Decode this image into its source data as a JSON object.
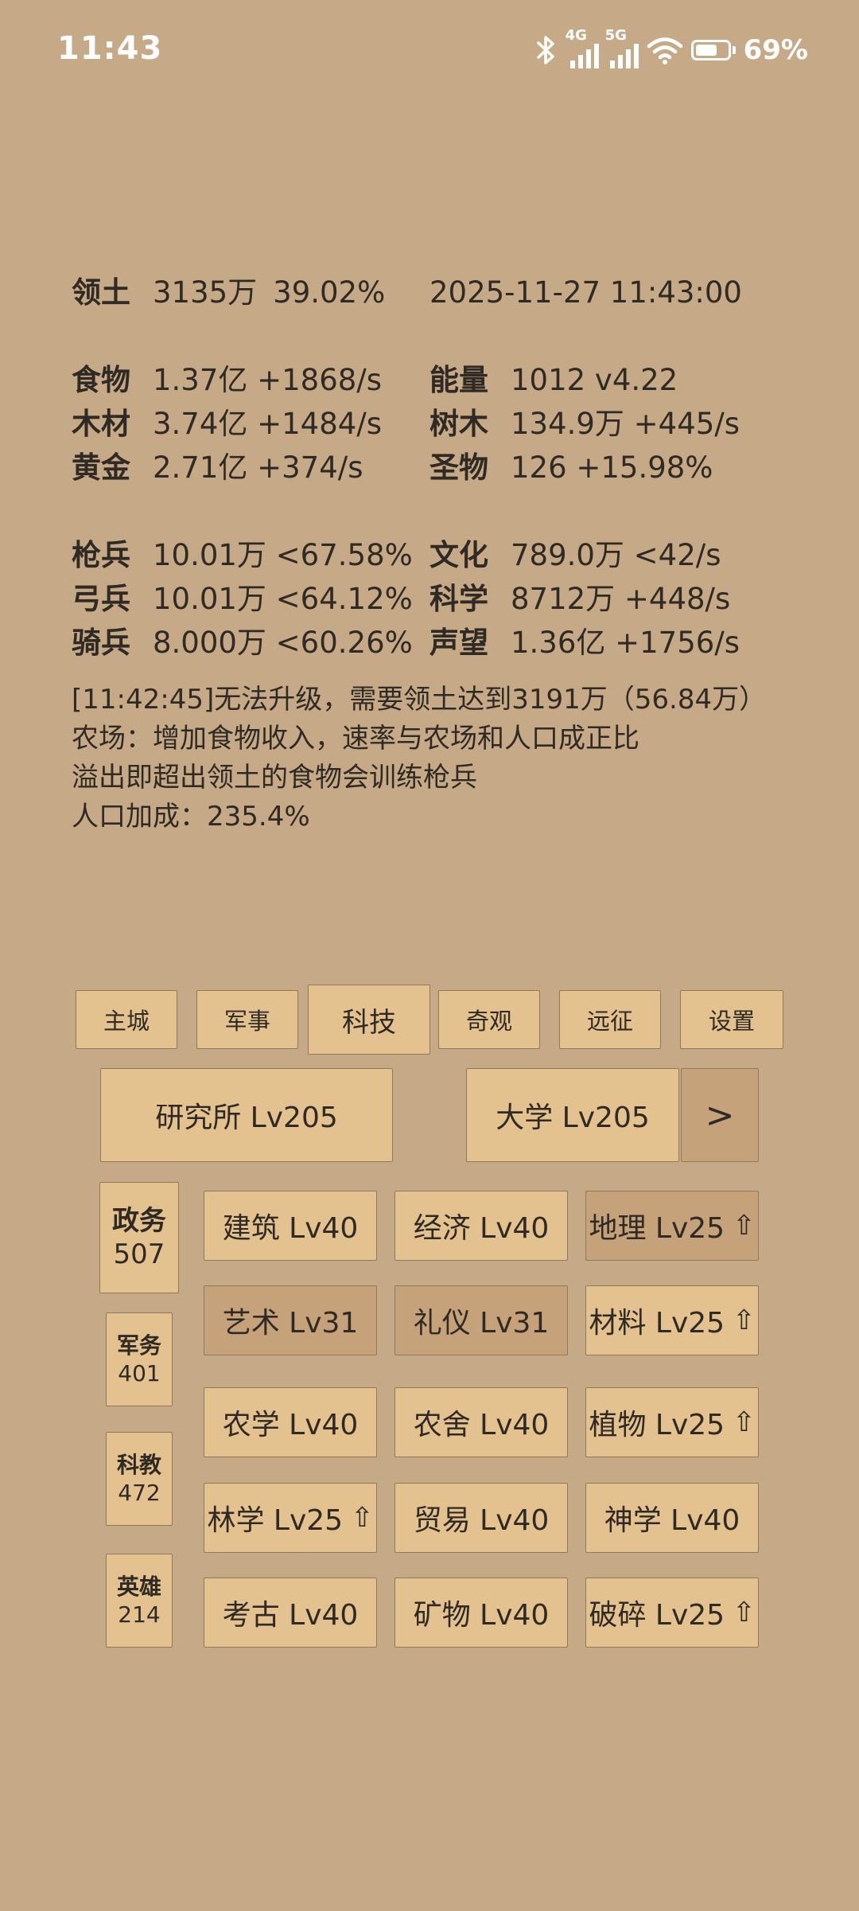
{
  "status_bar": {
    "time": "11:43",
    "network_4g": "4G",
    "network_5g": "5G",
    "battery_pct": "69%",
    "battery_level": 0.69,
    "icons": [
      "bluetooth-icon",
      "signal-4g-icon",
      "signal-5g-icon",
      "wifi-icon",
      "battery-icon"
    ]
  },
  "stats": {
    "territory_label": "领土",
    "territory_value": "3135万",
    "territory_pct": "39.02%",
    "datetime": "2025-11-27 11:43:00",
    "rows1": [
      {
        "k1": "食物",
        "v1": "1.37亿 +1868/s",
        "k2": "能量",
        "v2": "1012  v4.22"
      },
      {
        "k1": "木材",
        "v1": "3.74亿 +1484/s",
        "k2": "树木",
        "v2": "134.9万 +445/s"
      },
      {
        "k1": "黄金",
        "v1": "2.71亿 +374/s",
        "k2": "圣物",
        "v2": "126 +15.98%"
      }
    ],
    "rows2": [
      {
        "k1": "枪兵",
        "v1": "10.01万 <67.58%",
        "k2": "文化",
        "v2": "789.0万 <42/s"
      },
      {
        "k1": "弓兵",
        "v1": "10.01万 <64.12%",
        "k2": "科学",
        "v2": "8712万 +448/s"
      },
      {
        "k1": "骑兵",
        "v1": "8.000万 <60.26%",
        "k2": "声望",
        "v2": "1.36亿 +1756/s"
      }
    ]
  },
  "messages": {
    "line1": "[11:42:45]无法升级，需要领土达到3191万（56.84万）",
    "line2": "农场：增加食物收入，速率与农场和人口成正比",
    "line3": "溢出即超出领土的食物会训练枪兵",
    "line4": "人口加成：235.4%"
  },
  "tabs": [
    "主城",
    "军事",
    "科技",
    "奇观",
    "远征",
    "设置"
  ],
  "active_tab": "科技",
  "buildings": {
    "research": "研究所 Lv205",
    "university": "大学 Lv205",
    "next": ">"
  },
  "side": [
    {
      "title": "政务",
      "value": "507"
    },
    {
      "title": "军务",
      "value": "401"
    },
    {
      "title": "科教",
      "value": "472"
    },
    {
      "title": "英雄",
      "value": "214"
    }
  ],
  "upgrade_glyph": "⇧",
  "techs": [
    {
      "label": "建筑 Lv40",
      "up": false,
      "sel": false
    },
    {
      "label": "经济 Lv40",
      "up": false,
      "sel": false
    },
    {
      "label": "地理 Lv25",
      "up": true,
      "sel": true
    },
    {
      "label": "艺术 Lv31",
      "up": false,
      "sel": true
    },
    {
      "label": "礼仪 Lv31",
      "up": false,
      "sel": true
    },
    {
      "label": "材料 Lv25",
      "up": true,
      "sel": false
    },
    {
      "label": "农学 Lv40",
      "up": false,
      "sel": false
    },
    {
      "label": "农舍 Lv40",
      "up": false,
      "sel": false
    },
    {
      "label": "植物 Lv25",
      "up": true,
      "sel": false
    },
    {
      "label": "林学 Lv25",
      "up": true,
      "sel": false
    },
    {
      "label": "贸易 Lv40",
      "up": false,
      "sel": false
    },
    {
      "label": "神学 Lv40",
      "up": false,
      "sel": false
    },
    {
      "label": "考古 Lv40",
      "up": false,
      "sel": false
    },
    {
      "label": "矿物 Lv40",
      "up": false,
      "sel": false
    },
    {
      "label": "破碎 Lv25",
      "up": true,
      "sel": false
    }
  ]
}
